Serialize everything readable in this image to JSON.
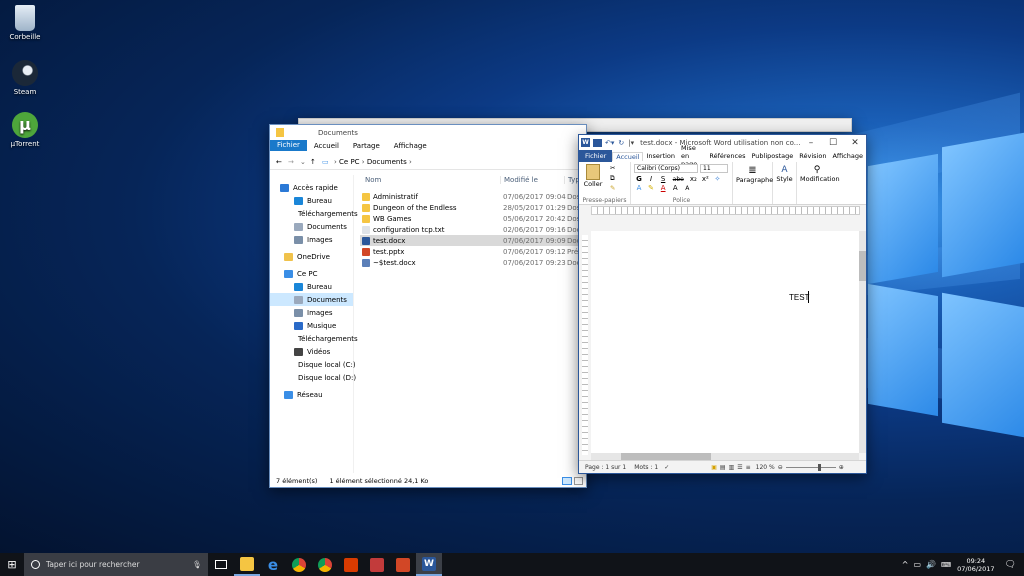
{
  "desktop": {
    "icons": [
      {
        "label": "Corbeille"
      },
      {
        "label": "Steam"
      },
      {
        "label": "µTorrent"
      }
    ]
  },
  "explorer": {
    "title": "Documents",
    "tabs": {
      "file": "Fichier",
      "home": "Accueil",
      "share": "Partage",
      "view": "Affichage"
    },
    "breadcrumb": {
      "root": "Ce PC",
      "current": "Documents"
    },
    "nav": [
      {
        "label": "Accès rapide",
        "color": "#2b79d6"
      },
      {
        "label": "Bureau",
        "color": "#1a86d8"
      },
      {
        "label": "Téléchargements",
        "color": "#1a6dc0"
      },
      {
        "label": "Documents",
        "color": "#9aa9bd"
      },
      {
        "label": "Images",
        "color": "#7a8fa8"
      },
      {
        "label": "OneDrive",
        "color": "#f0c24b"
      },
      {
        "label": "Ce PC",
        "color": "#3a8ee6"
      },
      {
        "label": "Bureau",
        "color": "#1a86d8"
      },
      {
        "label": "Documents",
        "color": "#9aa9bd"
      },
      {
        "label": "Images",
        "color": "#7a8fa8"
      },
      {
        "label": "Musique",
        "color": "#2a6ac8"
      },
      {
        "label": "Téléchargements",
        "color": "#1a6dc0"
      },
      {
        "label": "Vidéos",
        "color": "#444444"
      },
      {
        "label": "Disque local (C:)",
        "color": "#7b8796"
      },
      {
        "label": "Disque local (D:)",
        "color": "#7b8796"
      },
      {
        "label": "Réseau",
        "color": "#3a8ee6"
      }
    ],
    "columns": {
      "name": "Nom",
      "modified": "Modifié le",
      "type": "Typ"
    },
    "files": [
      {
        "name": "Administratif",
        "date": "07/06/2017 09:04",
        "type": "Dos",
        "color": "#f5c542"
      },
      {
        "name": "Dungeon of the Endless",
        "date": "28/05/2017 01:29",
        "type": "Dos",
        "color": "#f5c542"
      },
      {
        "name": "WB Games",
        "date": "05/06/2017 20:42",
        "type": "Dos",
        "color": "#f5c542"
      },
      {
        "name": "configuration tcp.txt",
        "date": "02/06/2017 09:16",
        "type": "Doc",
        "color": "#dfe3e8"
      },
      {
        "name": "test.docx",
        "date": "07/06/2017 09:09",
        "type": "Doc",
        "color": "#2b579a"
      },
      {
        "name": "test.pptx",
        "date": "07/06/2017 09:12",
        "type": "Pré",
        "color": "#d24726"
      },
      {
        "name": "~$test.docx",
        "date": "07/06/2017 09:23",
        "type": "Doc",
        "color": "#5b7fb8"
      }
    ],
    "status": {
      "count": "7 élément(s)",
      "selection": "1 élément sélectionné  24,1 Ko"
    }
  },
  "word": {
    "title": "test.docx - Microsoft Word utilisation non co...",
    "tabs": [
      "Fichier",
      "Accueil",
      "Insertion",
      "Mise en page",
      "Références",
      "Publipostage",
      "Révision",
      "Affichage"
    ],
    "clipboard": {
      "paste": "Coller",
      "label": "Presse-papiers"
    },
    "font": {
      "name": "Calibri (Corps)",
      "size": "11",
      "label": "Police",
      "bold": "G",
      "italic": "I",
      "underline": "S",
      "strike": "abe",
      "sub": "x₂",
      "sup": "x²"
    },
    "groups": {
      "paragraph": "Paragraphe",
      "style": "Style",
      "edit": "Modification"
    },
    "doc_text": "TEST",
    "status": {
      "page": "Page : 1 sur 1",
      "words": "Mots : 1",
      "zoom": "120 %"
    }
  },
  "taskbar": {
    "search": "Taper ici pour rechercher",
    "time": "09:24",
    "date": "07/06/2017"
  }
}
